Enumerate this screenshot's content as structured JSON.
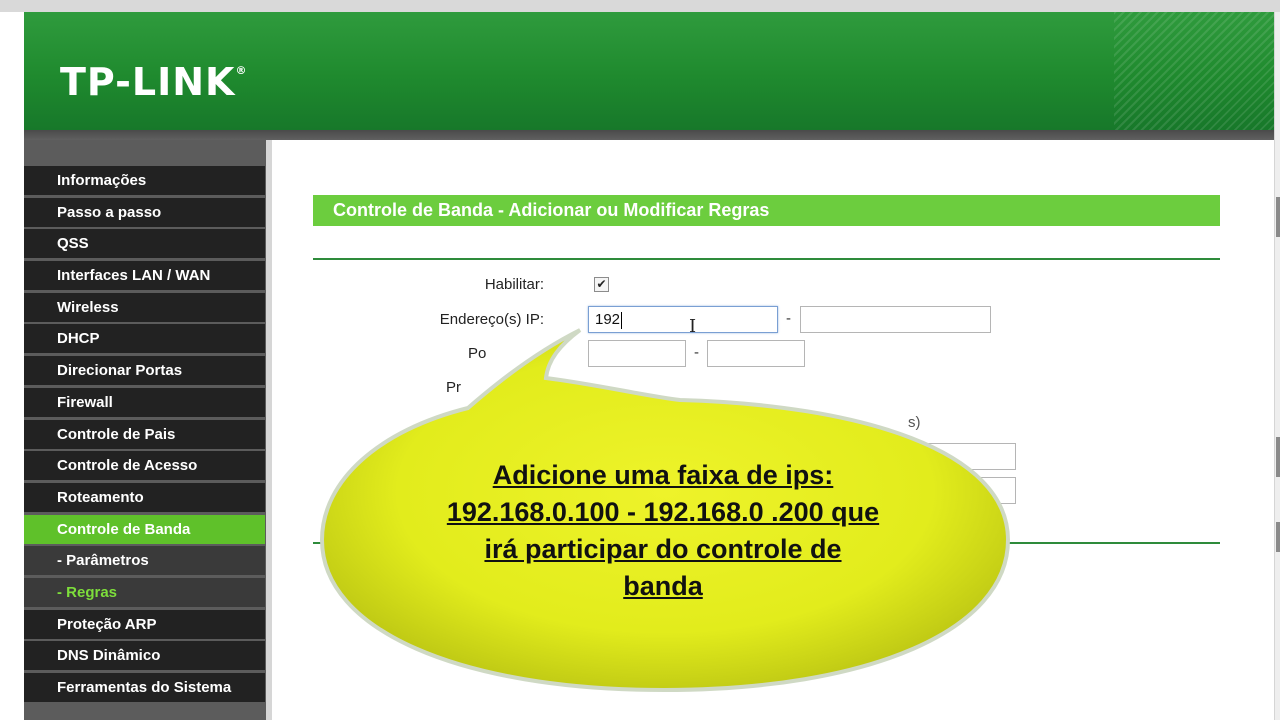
{
  "brand": {
    "logo_text": "TP-LINK",
    "registered_mark": "®"
  },
  "sidebar": {
    "items": [
      {
        "label": "Informações",
        "state": "normal"
      },
      {
        "label": "Passo a passo",
        "state": "normal"
      },
      {
        "label": "QSS",
        "state": "normal"
      },
      {
        "label": "Interfaces LAN / WAN",
        "state": "normal"
      },
      {
        "label": "Wireless",
        "state": "normal"
      },
      {
        "label": "DHCP",
        "state": "normal"
      },
      {
        "label": "Direcionar Portas",
        "state": "normal"
      },
      {
        "label": "Firewall",
        "state": "normal"
      },
      {
        "label": "Controle de Pais",
        "state": "normal"
      },
      {
        "label": "Controle de Acesso",
        "state": "normal"
      },
      {
        "label": "Roteamento",
        "state": "normal"
      },
      {
        "label": "Controle de Banda",
        "state": "active"
      },
      {
        "label": "- Parâmetros",
        "state": "sub"
      },
      {
        "label": "- Regras",
        "state": "sub-current"
      },
      {
        "label": "Proteção ARP",
        "state": "normal"
      },
      {
        "label": "DNS Dinâmico",
        "state": "normal"
      },
      {
        "label": "Ferramentas do Sistema",
        "state": "normal"
      }
    ]
  },
  "main": {
    "title": "Controle de Banda - Adicionar ou Modificar Regras",
    "form": {
      "enable_label": "Habilitar:",
      "enable_checked": true,
      "enable_check_glyph": "✔",
      "ip_label": "Endereço(s) IP:",
      "ip_start_value": "192",
      "ip_end_value": "",
      "separator": "-",
      "port_label_partial": "Po",
      "port_start_value": "",
      "port_end_value": "",
      "protocol_label_partial": "Pr",
      "bandwidth_hint_partial": "s)"
    }
  },
  "callout": {
    "lines": [
      "Adicione uma faixa de ips: ",
      "192.168.0.100 - 192.168.0 .200 que",
      "irá participar do controle de ",
      "banda"
    ]
  },
  "colors": {
    "header_green": "#1f8a2e",
    "menu_active": "#5fc12a",
    "menu_bg": "#222222",
    "title_bar": "#6ccd3e",
    "bubble_fill": "#e6ef1e"
  }
}
